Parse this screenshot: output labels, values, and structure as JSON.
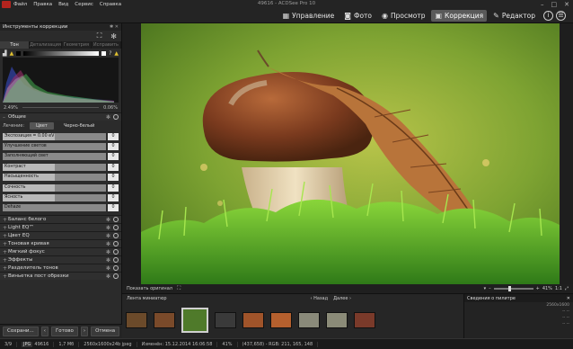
{
  "menu": [
    "Файл",
    "Правка",
    "Вид",
    "Сервис",
    "Справка"
  ],
  "window_title": "49616 - ACDSee Pro 10",
  "window_controls": [
    "–",
    "□",
    "✕"
  ],
  "modes": [
    {
      "label": "Управление",
      "icon": "grid-icon",
      "glyph": "▦",
      "active": false
    },
    {
      "label": "Фото",
      "icon": "camera-icon",
      "glyph": "◙",
      "active": false
    },
    {
      "label": "Просмотр",
      "icon": "eye-icon",
      "glyph": "◉",
      "active": false
    },
    {
      "label": "Коррекция",
      "icon": "picture-icon",
      "glyph": "▣",
      "active": true
    },
    {
      "label": "Редактор",
      "icon": "brush-icon",
      "glyph": "✎",
      "active": false
    }
  ],
  "panel": {
    "title": "Инструменты коррекции",
    "tabs": [
      "Тон",
      "Детализация",
      "Геометрия",
      "Исправить"
    ],
    "histogram": {
      "left_pct": "2.49%",
      "right_pct": "0.06%"
    },
    "main_section": "Общие",
    "mode_label": "Лечение:",
    "mode_options": [
      {
        "label": "Цвет",
        "on": true
      },
      {
        "label": "Черно-белый",
        "on": false
      }
    ],
    "sliders": [
      {
        "label": "Экспозиция = 0.00 eV",
        "value": "0",
        "fill": 0.5
      },
      {
        "label": "Улучшение светов",
        "value": "0",
        "fill": 0
      },
      {
        "label": "Заполняющий свет",
        "value": "0",
        "fill": 0
      },
      {
        "label": "Контраст",
        "value": "0",
        "fill": 0.5
      },
      {
        "label": "Насыщенность",
        "value": "0",
        "fill": 0.5
      },
      {
        "label": "Сочность",
        "value": "0",
        "fill": 0.5
      },
      {
        "label": "Ясность",
        "value": "0",
        "fill": 0.5
      },
      {
        "label": "Dehaze",
        "value": "0",
        "fill": 0
      }
    ],
    "sections": [
      "Баланс белого",
      "Light EQ™",
      "Цвет EQ",
      "Тоновая кривая",
      "Мягкий фокус",
      "Эффекты",
      "Разделитель тонов",
      "Виньетка пост обрезки"
    ],
    "buttons": {
      "save": "Сохрани...",
      "done": "Готово",
      "cancel": "Отмена"
    }
  },
  "view": {
    "show_original": "Показать оригинал",
    "zoom": "41%"
  },
  "filmstrip": {
    "title": "Лента миниатюр",
    "back": "Назад",
    "next": "Далее",
    "thumbs": [
      {
        "color": "#6b4a2a",
        "selected": false
      },
      {
        "color": "#7a4a2a",
        "selected": false
      },
      {
        "color": "#4f7a2a",
        "selected": true
      },
      {
        "color": "#3a3a3a",
        "selected": false
      },
      {
        "color": "#a0542a",
        "selected": false
      },
      {
        "color": "#b5602e",
        "selected": false
      },
      {
        "color": "#8a8a7a",
        "selected": false
      },
      {
        "color": "#8b8b78",
        "selected": false
      },
      {
        "color": "#7a3a2a",
        "selected": false
      }
    ]
  },
  "meta": {
    "title": "Сведения о пилитре",
    "rows": [
      "2560x1600",
      "-- --",
      "-- --",
      "-- --"
    ]
  },
  "status": {
    "index": "3/9",
    "format": "JPG",
    "name": "49616",
    "size": "1,7 Мб",
    "dims": "2560x1600x24b jpeg",
    "modified": "Изменён: 15.12.2014 16:06:58",
    "zoom": "41%",
    "pixel": "(437,658) - RGB: 211, 165, 148"
  },
  "colors": {
    "accent": "#5a5a5a",
    "logo": "#b3241e"
  }
}
